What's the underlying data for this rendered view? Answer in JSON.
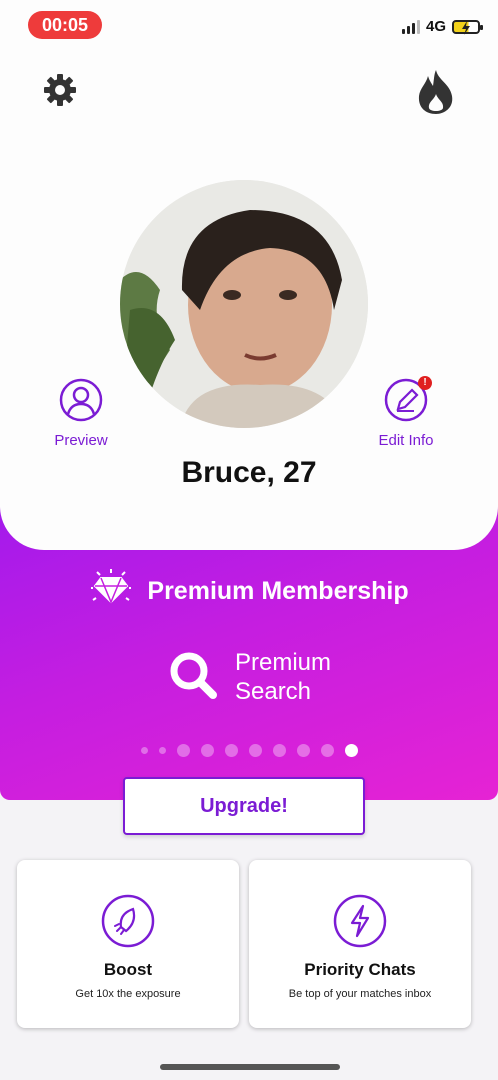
{
  "status_bar": {
    "time": "00:05",
    "network": "4G"
  },
  "profile": {
    "name": "Bruce, 27",
    "photo_alt": "Profile photo"
  },
  "actions": {
    "preview_label": "Preview",
    "edit_label": "Edit Info",
    "edit_badge": "!"
  },
  "premium": {
    "title": "Premium Membership",
    "feature_line1": "Premium",
    "feature_line2": "Search",
    "carousel_total": 10,
    "carousel_active": 10
  },
  "upgrade_label": "Upgrade!",
  "tiles": [
    {
      "title": "Boost",
      "subtitle": "Get 10x the exposure",
      "icon": "rocket-icon"
    },
    {
      "title": "Priority Chats",
      "subtitle": "Be top of your matches inbox",
      "icon": "lightning-icon"
    }
  ],
  "colors": {
    "accent": "#7b1cd4",
    "gradient_start": "#a21aec",
    "gradient_end": "#e623d4",
    "time_pill": "#ee3b3b"
  }
}
